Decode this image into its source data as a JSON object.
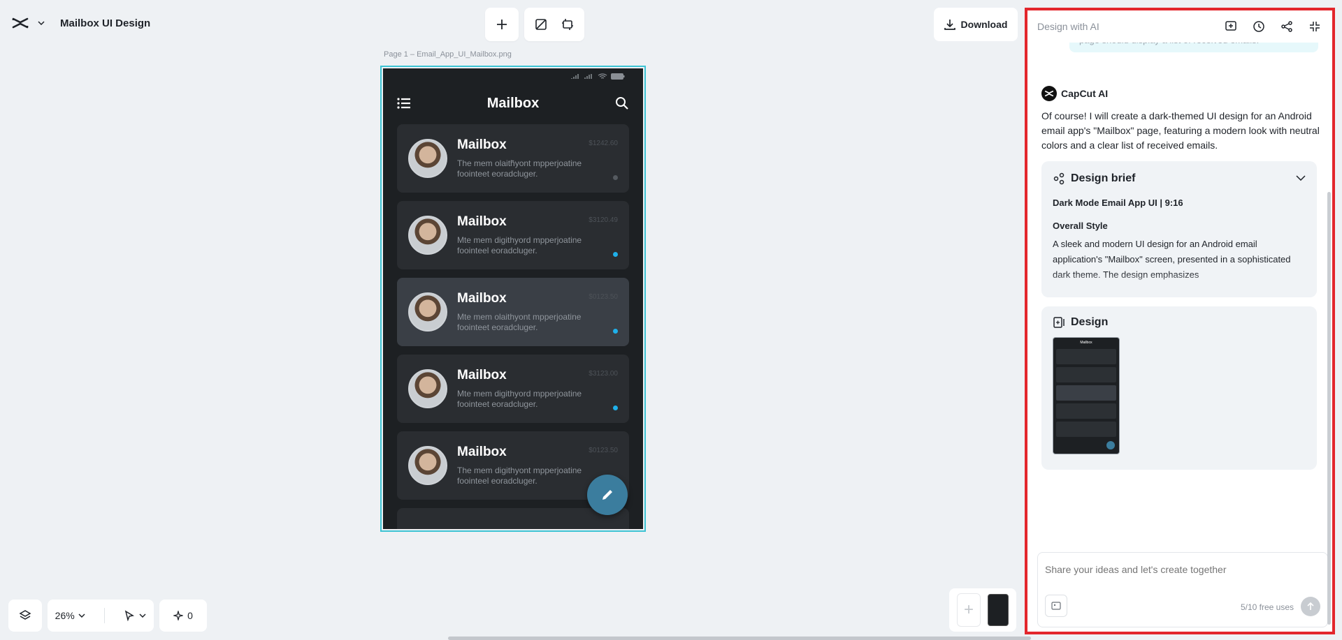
{
  "project": {
    "title": "Mailbox UI Design"
  },
  "toolbar": {
    "download_label": "Download"
  },
  "canvas": {
    "page_label": "Page 1 –  Email_App_UI_Mailbox.png",
    "zoom": "26%",
    "effects_count": "0"
  },
  "phone": {
    "title": "Mailbox",
    "emails": [
      {
        "sender": "Mailbox",
        "preview": "The mem  olaith̃yont  mpperjoatine foointeet  eoradcluger.",
        "time": "$1242.60",
        "unread": false
      },
      {
        "sender": "Mailbox",
        "preview": "Mte mem  digithyord  mpperjoatine foointeel  eoradcluger.",
        "time": "$3120.49",
        "unread": true
      },
      {
        "sender": "Mailbox",
        "preview": "Mte mem  olaithyont  mpperjoatine foointeet  eoradcluger.",
        "time": "$0123.50",
        "unread": true
      },
      {
        "sender": "Mailbox",
        "preview": "Mte mem  digithyord  mpperjoatine foointeet  eoradcluger.",
        "time": "$3123.00",
        "unread": true
      },
      {
        "sender": "Mailbox",
        "preview": "The mem  digithyont  mpperjoatine foointeel  eoradcluger.",
        "time": "$0123.50",
        "unread": false
      }
    ]
  },
  "panel": {
    "title": "Design with AI",
    "user_message_tail": "page should display a list of received emails.",
    "ai_name": "CapCut AI",
    "ai_message": "Of course! I will create a dark-themed UI design for an Android email app's \"Mailbox\" page, featuring a modern look with neutral colors and a clear list of received emails.",
    "brief": {
      "heading": "Design brief",
      "subtitle": "Dark Mode Email App UI | 9:16",
      "style_heading": "Overall Style",
      "style_text": "A sleek and modern UI design for an Android email application's \"Mailbox\" screen, presented in a sophisticated dark theme. The design emphasizes"
    },
    "design_heading": "Design",
    "thumb_title": "Mailbox",
    "composer_placeholder": "Share your ideas and let's create together",
    "free_uses": "5/10 free uses"
  },
  "colors": {
    "accent_frame": "#3cc3d3",
    "panel_border": "#e3262c",
    "unread_dot": "#1fb0ea",
    "fab": "#3b7d9e"
  }
}
